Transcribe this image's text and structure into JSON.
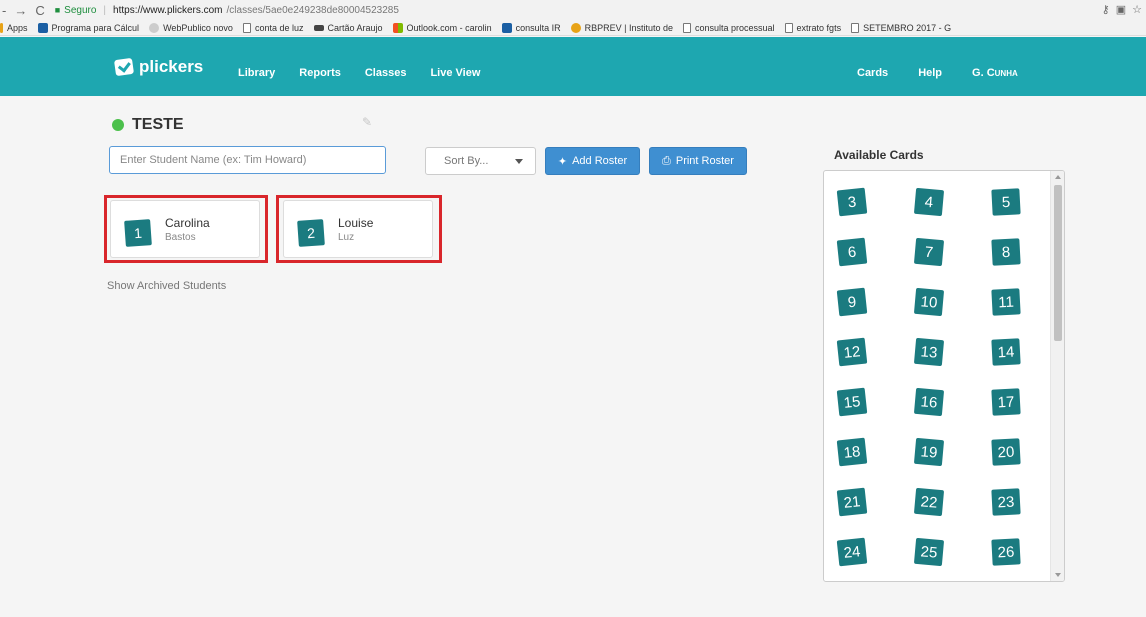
{
  "browser": {
    "secure_label": "Seguro",
    "url_main": "https://www.plickers.com",
    "url_path": "/classes/5ae0e249238de80004523285",
    "bookmarks": [
      "Apps",
      "Programa para Cálcul",
      "WebPublico novo",
      "conta de luz",
      "Cartão Araujo",
      "Outlook.com - carolin",
      "consulta IR",
      "RBPREV | Instituto de",
      "consulta processual",
      "extrato fgts",
      "SETEMBRO 2017 - G"
    ]
  },
  "header": {
    "logo": "plickers",
    "nav_left": [
      "Library",
      "Reports",
      "Classes",
      "Live View"
    ],
    "nav_right": [
      "Cards",
      "Help"
    ],
    "user": "G. Cunha",
    "color": "#1ea7b0"
  },
  "class": {
    "name": "TESTE",
    "status_color": "#4cc04c"
  },
  "controls": {
    "student_placeholder": "Enter Student Name (ex: Tim Howard)",
    "sort_label": "Sort By...",
    "add_roster": "Add Roster",
    "print_roster": "Print Roster"
  },
  "students": [
    {
      "card": "1",
      "first": "Carolina",
      "last": "Bastos"
    },
    {
      "card": "2",
      "first": "Louise",
      "last": "Luz"
    }
  ],
  "show_archived": "Show Archived Students",
  "available": {
    "title": "Available Cards",
    "cards": [
      "3",
      "4",
      "5",
      "6",
      "7",
      "8",
      "9",
      "10",
      "11",
      "12",
      "13",
      "14",
      "15",
      "16",
      "17",
      "18",
      "19",
      "20",
      "21",
      "22",
      "23",
      "24",
      "25",
      "26"
    ]
  }
}
